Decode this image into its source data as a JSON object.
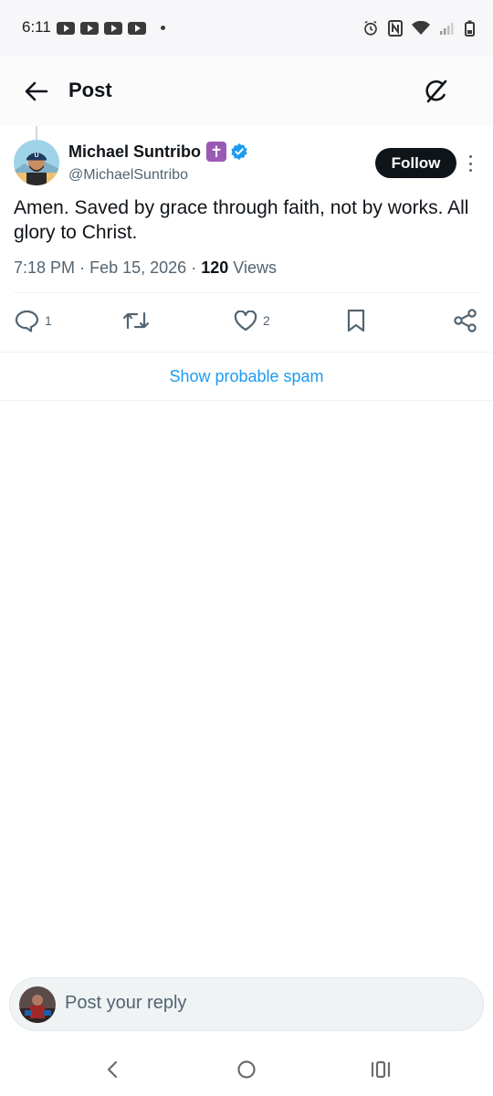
{
  "status_bar": {
    "time": "6:11",
    "notification_icons": [
      "youtube-icon",
      "youtube-icon",
      "youtube-icon",
      "youtube-icon"
    ],
    "right_icons": [
      "alarm-icon",
      "nfc-icon",
      "wifi-icon",
      "signal-icon",
      "battery-icon"
    ]
  },
  "header": {
    "title": "Post",
    "back_icon": "arrow-left-icon",
    "grok_icon": "grok-icon"
  },
  "post": {
    "author_name": "Michael Suntribo",
    "badge_glyph": "✝",
    "handle": "@MichaelSuntribo",
    "follow_label": "Follow",
    "text": "Amen. Saved by grace through faith, not by works. All glory to Christ.",
    "time": "7:18 PM",
    "separator": "·",
    "date": "Feb 15, 2026",
    "views_count": "120",
    "views_label": "Views",
    "replies": "1",
    "likes": "2"
  },
  "spam_link": "Show probable spam",
  "reply_bar": {
    "placeholder": "Post your reply"
  },
  "colors": {
    "accent": "#1d9bf0",
    "text_primary": "#0f1419",
    "text_secondary": "#536471",
    "badge_purple": "#9b59b6"
  }
}
